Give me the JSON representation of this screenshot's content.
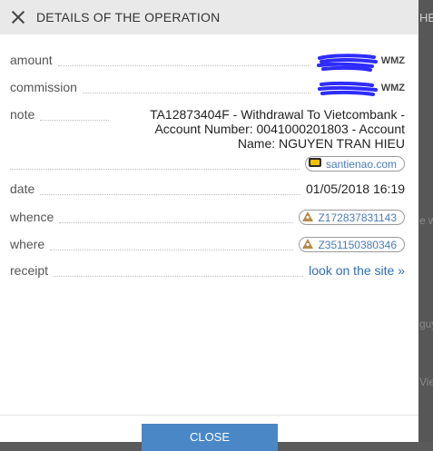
{
  "background": {
    "fragments": [
      "HB",
      "e w",
      "guy",
      "Vie"
    ]
  },
  "dialog": {
    "title": "DETAILS OF THE OPERATION",
    "fields": {
      "amount": {
        "label": "amount",
        "currency": "WMZ"
      },
      "commission": {
        "label": "commission",
        "currency": "WMZ"
      },
      "note": {
        "label": "note",
        "lines": [
          "TA12873404F - Withdrawal To Vietcombank -",
          "Account Number: 0041000201803 - Account",
          "Name: NGUYEN TRAN HIEU"
        ]
      },
      "source_site": "santienao.com",
      "date": {
        "label": "date",
        "value": "01/05/2018 16:19"
      },
      "whence": {
        "label": "whence",
        "value": "Z172837831143"
      },
      "where": {
        "label": "where",
        "value": "Z351150380346"
      },
      "receipt": {
        "label": "receipt",
        "value": "look on the site »"
      }
    },
    "close_button": "CLOSE"
  },
  "colors": {
    "accent": "#4a87c6",
    "link": "#2f6fb6",
    "redaction": "#2f2cff"
  }
}
